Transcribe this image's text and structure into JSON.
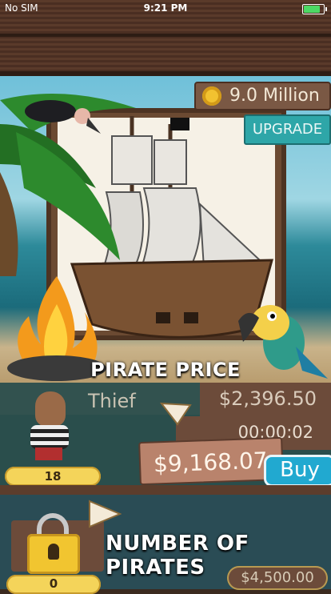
{
  "status_bar": {
    "carrier": "No SIM",
    "time": "9:21 PM",
    "battery_level": 0.85
  },
  "header": {
    "coins": "9.0 Million",
    "upgrade_label": "UPGRADE"
  },
  "pirate_price_label": "PIRATE PRICE",
  "pirate_card": {
    "name": "Thief",
    "price": "$2,396.50",
    "timer": "00:00:02",
    "earnings": "$9,168.07",
    "buy_label": "Buy",
    "level": "18"
  },
  "number_of_pirates": {
    "label": "NUMBER OF PIRATES",
    "cost": "$4,500.00",
    "count": "0"
  },
  "colors": {
    "accent": "#21a9d0",
    "gold": "#f4d45a",
    "wood": "#6c4b3a",
    "upgrade": "#2ea6a8"
  },
  "icons": [
    "coin-icon",
    "battery-icon",
    "arrow-icon",
    "lock-icon",
    "ship-illustration",
    "parrot-illustration",
    "vulture-illustration",
    "campfire-illustration"
  ]
}
